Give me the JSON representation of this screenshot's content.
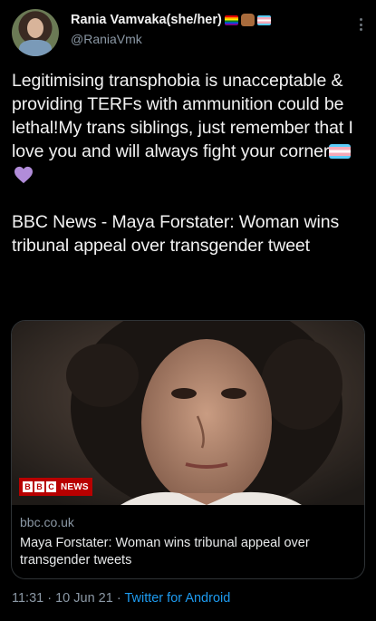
{
  "author": {
    "display_name": "Rania Vamvaka(she/her)",
    "handle": "@RaniaVmk",
    "name_emojis": [
      "rainbow-flag-icon",
      "raised-fist-icon",
      "transgender-flag-icon"
    ]
  },
  "tweet": {
    "paragraph1": "Legitimising transphobia is unacceptable & providing TERFs with ammunition could be lethal!My trans siblings, just remember that I love you and will always fight your corner",
    "paragraph1_emojis": [
      "transgender-flag-icon",
      "purple-heart-icon"
    ],
    "paragraph2": "BBC News - Maya Forstater: Woman wins tribunal appeal over transgender tweet"
  },
  "link_card": {
    "badge_letters": [
      "B",
      "B",
      "C"
    ],
    "badge_text": "NEWS",
    "domain": "bbc.co.uk",
    "title": "Maya Forstater: Woman wins tribunal appeal over transgender tweets"
  },
  "footer": {
    "time": "11:31",
    "separator": " · ",
    "date": "10 Jun 21",
    "source": "Twitter for Android"
  },
  "colors": {
    "background": "#000000",
    "text": "#e7e9ea",
    "muted": "#8b98a5",
    "link": "#1d9bf0",
    "bbc_red": "#b80000",
    "heart": "#b18cd9"
  }
}
